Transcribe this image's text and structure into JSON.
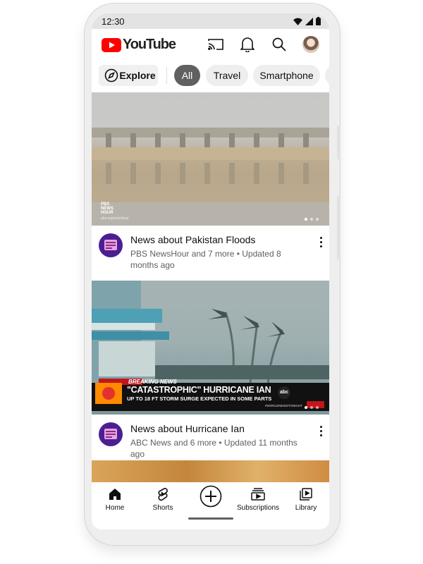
{
  "status_bar": {
    "time": "12:30"
  },
  "app_bar": {
    "logo_text": "YouTube",
    "icons": [
      "cast-icon",
      "bell-icon",
      "search-icon",
      "avatar"
    ]
  },
  "chips": {
    "explore_label": "Explore",
    "items": [
      "All",
      "Travel",
      "Smartphone"
    ],
    "selected": "All"
  },
  "feed": [
    {
      "title": "News about Pakistan Floods",
      "subtitle": "PBS NewsHour and 7 more • Updated 8 months ago",
      "thumbnail_overlay": {
        "logo_line1": "PBS",
        "logo_line2": "NEWS",
        "logo_line3": "HOUR",
        "source": "pbs.org/newshour"
      },
      "carousel_dots": 3,
      "carousel_active": 0
    },
    {
      "title": "News about Hurricane Ian",
      "subtitle": "ABC News and 6 more • Updated 11 months ago",
      "thumbnail_overlay": {
        "banner": "BREAKING NEWS",
        "headline": "\"CATASTROPHIC\" HURRICANE IAN",
        "ticker": "UP TO 18 FT STORM SURGE EXPECTED IN SOME PARTS",
        "network": "abc",
        "hashtag": "#WORLDNEWSTONIGHT"
      },
      "carousel_dots": 3,
      "carousel_active": 0
    }
  ],
  "bottom_nav": {
    "items": [
      {
        "label": "Home",
        "icon": "home-icon"
      },
      {
        "label": "Shorts",
        "icon": "shorts-icon"
      },
      {
        "label": "",
        "icon": "create-icon"
      },
      {
        "label": "Subscriptions",
        "icon": "subscriptions-icon"
      },
      {
        "label": "Library",
        "icon": "library-icon"
      }
    ]
  },
  "colors": {
    "brand_red": "#ff0000",
    "chip_selected": "#606060",
    "channel_avatar": "#4b1f94"
  }
}
